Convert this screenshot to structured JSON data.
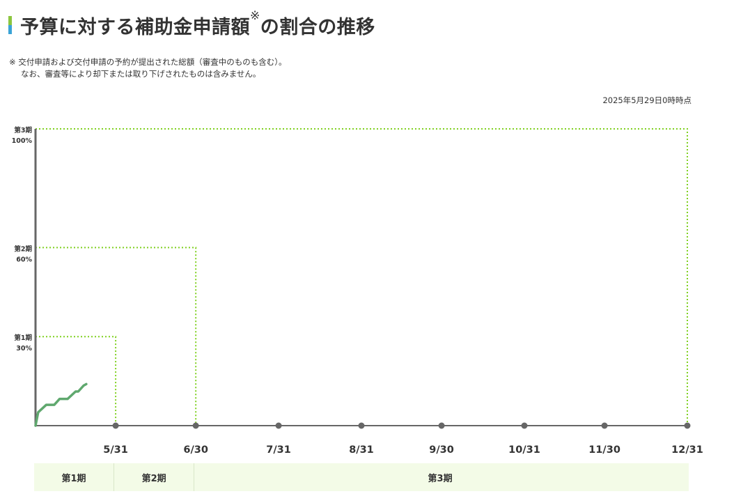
{
  "page": {
    "title": "予算に対する補助金申請額",
    "title_mark": "※",
    "title_suffix": "の割合の推移",
    "note_line1": "※ 交付申請および交付申請の予約が提出された総額（審査中のものも含む）。",
    "note_line2": "なお、審査等により却下または取り下げされたものは含みません。",
    "as_of": "2025年5月29日0時時点"
  },
  "chart_data": {
    "type": "line",
    "x_ticks": [
      "5/31",
      "6/30",
      "7/31",
      "8/31",
      "9/30",
      "10/31",
      "11/30",
      "12/31"
    ],
    "x_range": [
      "5/1",
      "12/31"
    ],
    "y_range": [
      0,
      100
    ],
    "y_unit": "%",
    "thresholds": [
      {
        "label": "第1期",
        "value_label": "30%",
        "value": 30,
        "end": "5/31"
      },
      {
        "label": "第2期",
        "value_label": "60%",
        "value": 60,
        "end": "6/30"
      },
      {
        "label": "第3期",
        "value_label": "100%",
        "value": 100,
        "end": "12/31"
      }
    ],
    "series": [
      {
        "values": [
          {
            "x": "5/1",
            "y": 0
          },
          {
            "x": "5/2",
            "y": 4.5
          },
          {
            "x": "5/5",
            "y": 7
          },
          {
            "x": "5/8",
            "y": 7
          },
          {
            "x": "5/10",
            "y": 9
          },
          {
            "x": "5/13",
            "y": 9
          },
          {
            "x": "5/16",
            "y": 11.5
          },
          {
            "x": "5/17",
            "y": 11.5
          },
          {
            "x": "5/19",
            "y": 13.5
          },
          {
            "x": "5/20",
            "y": 14
          }
        ]
      }
    ],
    "periods": [
      {
        "label": "第1期",
        "start": "5/1",
        "end": "5/31"
      },
      {
        "label": "第2期",
        "start": "5/31",
        "end": "6/30"
      },
      {
        "label": "第3期",
        "start": "6/30",
        "end": "12/31"
      }
    ],
    "colors": {
      "line": "#5fa86e",
      "threshold": "#7fd01f",
      "axis": "#666666",
      "band": "#f3fbe7"
    },
    "grid": false,
    "legend": "none"
  }
}
